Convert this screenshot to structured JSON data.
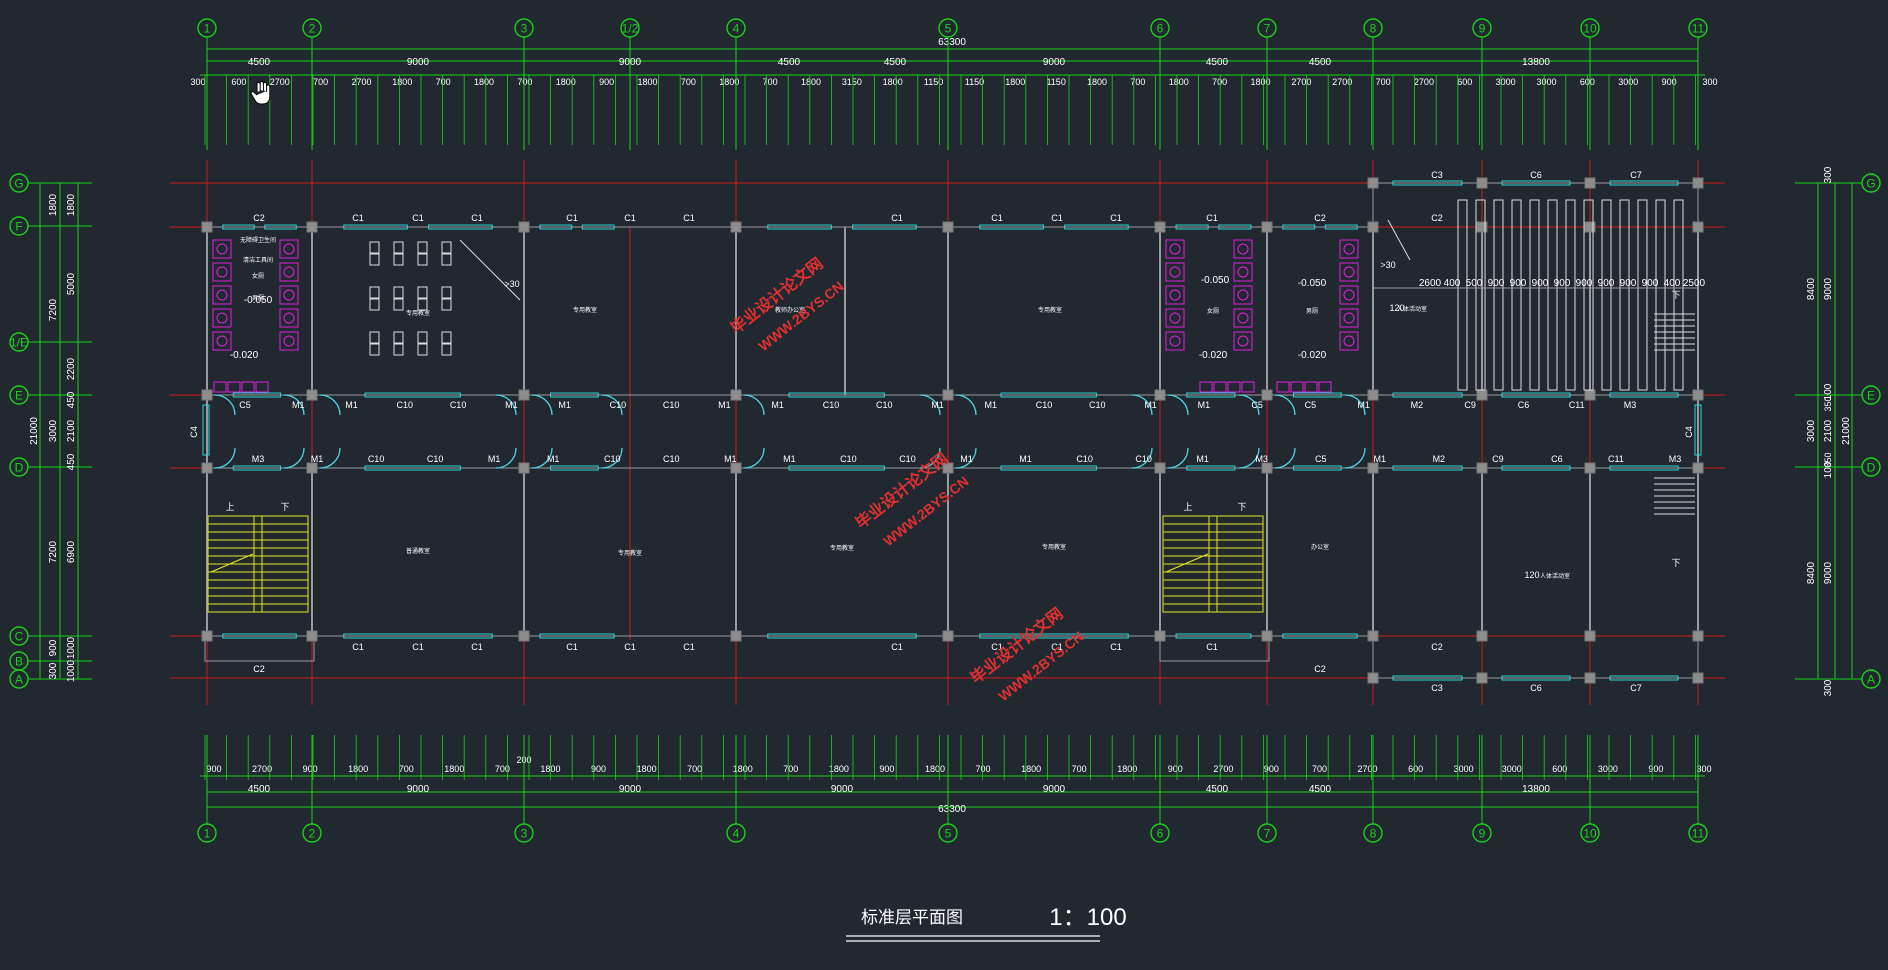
{
  "colors": {
    "background": "#212830",
    "dimension": "#19d219",
    "axis_red": "#d01c1c",
    "wall": "#9a9aa0",
    "window": "#2ad6d6",
    "door": "#4ad4e6",
    "fixture": "#e020e0",
    "stair": "#e6e620",
    "text": "#ffffff",
    "watermark": "#e03030"
  },
  "axes_vertical": [
    "1",
    "2",
    "3",
    "1/2",
    "4",
    "5",
    "6",
    "7",
    "8",
    "9",
    "10",
    "11"
  ],
  "axes_bottom": [
    "1",
    "2",
    "3",
    "4",
    "5",
    "6",
    "7",
    "8",
    "9",
    "10",
    "11"
  ],
  "axes_left": [
    "G",
    "F",
    "1/E",
    "E",
    "D",
    "C",
    "B",
    "A"
  ],
  "axes_right": [
    "G",
    "E",
    "D",
    "A"
  ],
  "dims": {
    "total": "63300",
    "top_segments": [
      "4500",
      "9000",
      "9000",
      "4500",
      "4500",
      "9000",
      "4500",
      "4500",
      "13800"
    ],
    "top_details": [
      "300",
      "600",
      "2700",
      "700",
      "2700",
      "1800",
      "700",
      "1800",
      "700",
      "1800",
      "900",
      "1800",
      "700",
      "1800",
      "700",
      "1800",
      "3150",
      "1800",
      "1150",
      "1150",
      "1800",
      "1150",
      "1800",
      "700",
      "1800",
      "700",
      "1800",
      "2700",
      "2700",
      "700",
      "2700",
      "600",
      "3000",
      "3000",
      "600",
      "3000",
      "900",
      "300"
    ],
    "bottom_segments": [
      "4500",
      "9000",
      "9000",
      "9000",
      "9000",
      "4500",
      "4500",
      "13800"
    ],
    "bottom_details": [
      "900",
      "2700",
      "900",
      "1800",
      "700",
      "1800",
      "700",
      "1800",
      "900",
      "1800",
      "700",
      "1800",
      "700",
      "1800",
      "900",
      "1800",
      "700",
      "1800",
      "700",
      "1800",
      "900",
      "2700",
      "900",
      "700",
      "2700",
      "600",
      "3000",
      "3000",
      "600",
      "3000",
      "900",
      "300"
    ],
    "bottom_small": "200",
    "left_outer": "21000",
    "left_parts": [
      "1800",
      "7200",
      "3000",
      "7200",
      "900",
      "300"
    ],
    "left_inner": [
      "1800",
      "5000",
      "2200",
      "450",
      "2100",
      "450",
      "6900",
      "1000",
      "1000"
    ],
    "right_outer": "21000",
    "right_parts": [
      "8400",
      "3000",
      "8400"
    ],
    "right_inner": [
      "300",
      "9000",
      "100",
      "2100",
      "100",
      "9000",
      "300"
    ],
    "right_mid": [
      "350",
      "350"
    ]
  },
  "labels": {
    "windows_top": [
      "C2",
      "C1",
      "C1",
      "C1",
      "C1",
      "C1",
      "C1",
      "C1",
      "C1",
      "C1",
      "C1",
      "C1",
      "C2",
      "C2",
      "C3",
      "C6",
      "C7"
    ],
    "windows_corr_n": [
      "C5",
      "M1",
      "M1",
      "C10",
      "C10",
      "M1",
      "M1",
      "C10",
      "C10",
      "M1",
      "M1",
      "C10",
      "C10",
      "M1",
      "M1",
      "C10",
      "C10",
      "M1",
      "M1",
      "C5",
      "C5",
      "M1",
      "M2",
      "C9",
      "C6",
      "C11",
      "M3"
    ],
    "windows_corr_s": [
      "M3",
      "M1",
      "C10",
      "C10",
      "M1",
      "M1",
      "C10",
      "C10",
      "M1",
      "M1",
      "C10",
      "C10",
      "M1",
      "M1",
      "C10",
      "C10",
      "M1",
      "M3",
      "C5",
      "M1",
      "M2",
      "C9",
      "C6",
      "C11",
      "M3"
    ],
    "windows_bottom": [
      "C2",
      "C1",
      "C1",
      "C1",
      "C1",
      "C1",
      "C1",
      "C1",
      "C1",
      "C1",
      "C1",
      "C1",
      "C2",
      "C2",
      "C3",
      "C6",
      "C7"
    ],
    "side_window": "C4",
    "levels": [
      "-0.050",
      "-0.020",
      "-0.050",
      "-0.050",
      "-0.020",
      "-0.020"
    ],
    "stair_up": "上",
    "stair_down": "下",
    "ramp": ">30",
    "room_120a": "120",
    "room_120b": "120",
    "room_dims": [
      "2600",
      "400",
      "500",
      "900",
      "900",
      "900",
      "900",
      "900",
      "900",
      "900",
      "900",
      "400",
      "2500"
    ],
    "room_vert": "5000",
    "room_small_text": [
      "女厕",
      "男厕",
      "专用教室",
      "专用教室",
      "教师办公室",
      "专用教室",
      "女厕",
      "男厕",
      "人体活动室",
      "普通教室",
      "专用教室",
      "专用教室",
      "专用教室",
      "办公室",
      "人体活动室",
      "无障碍卫生间",
      "清洁工具间"
    ]
  },
  "watermarks": [
    "毕业设计论文网",
    "WWW.2BYS.CN"
  ],
  "drawing_title": "标准层平面图",
  "drawing_scale": "1：100"
}
